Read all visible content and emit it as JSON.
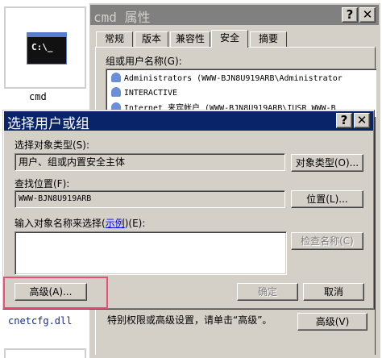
{
  "desktop": {
    "icon_label": "cmd",
    "icon_glyph": "C:\\_",
    "file_label": "cnetcfg.dll"
  },
  "properties_window": {
    "title": "cmd 属性",
    "help_btn": "?",
    "close_btn": "✕",
    "tabs": [
      "常规",
      "版本",
      "兼容性",
      "安全",
      "摘要"
    ],
    "group_label": "组或用户名称(G):",
    "entries": [
      "Administrators (WWW-BJN8U919ARB\\Administrator",
      "INTERACTIVE",
      "Internet 来宾帐户 (WWW-BJN8U919ARB\\IUSR_WWW-B"
    ],
    "bottom_text": "特别权限或高级设置，请单击“高级”。",
    "advanced_button": "高级(V)"
  },
  "select_dialog": {
    "title": "选择用户或组",
    "help_btn": "?",
    "close_btn": "✕",
    "object_type_label": "选择对象类型(S):",
    "object_type_value": "用户、组或内置安全主体",
    "object_type_button": "对象类型(O)...",
    "location_label": "查找位置(F):",
    "location_value": "WWW-BJN8U919ARB",
    "location_button": "位置(L)...",
    "names_label_prefix": "输入对象名称来选择(",
    "names_label_link": "示例",
    "names_label_suffix": ")(E):",
    "check_names_button": "检查名称(C)",
    "advanced_button": "高级(A)...",
    "ok_button": "确定",
    "cancel_button": "取消"
  },
  "colors": {
    "titlebar_active": "#0a246a",
    "titlebar_inactive": "#808080",
    "face": "#d4d0c8",
    "highlight_box": "#e8507a",
    "link": "#0000ff"
  }
}
